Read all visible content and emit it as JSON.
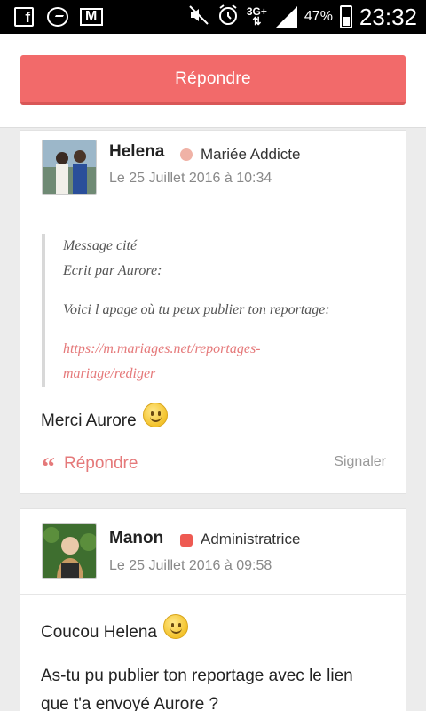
{
  "status_bar": {
    "battery": "47%",
    "time": "23:32",
    "network": "3G+"
  },
  "header": {
    "reply_button": "Répondre"
  },
  "posts": [
    {
      "author": "Helena",
      "role": "Mariée Addicte",
      "role_color": "#f0b2a6",
      "date": "Le 25 Juillet 2016 à 10:34",
      "quote": {
        "label": "Message cité",
        "by": "Ecrit par Aurore:",
        "text": "Voici l apage où tu peux publier ton reportage:",
        "link_line1": "https://m.mariages.net/reportages-",
        "link_line2": "mariage/rediger"
      },
      "message": "Merci Aurore",
      "reply": "Répondre",
      "report": "Signaler"
    },
    {
      "author": "Manon",
      "role": "Administratrice",
      "role_color": "#ee5a52",
      "date": "Le 25 Juillet 2016 à 09:58",
      "message_line1": "Coucou Helena",
      "message_line2": "As-tu pu publier ton reportage avec le lien",
      "message_line3": "que t'a envoyé Aurore ?"
    }
  ]
}
